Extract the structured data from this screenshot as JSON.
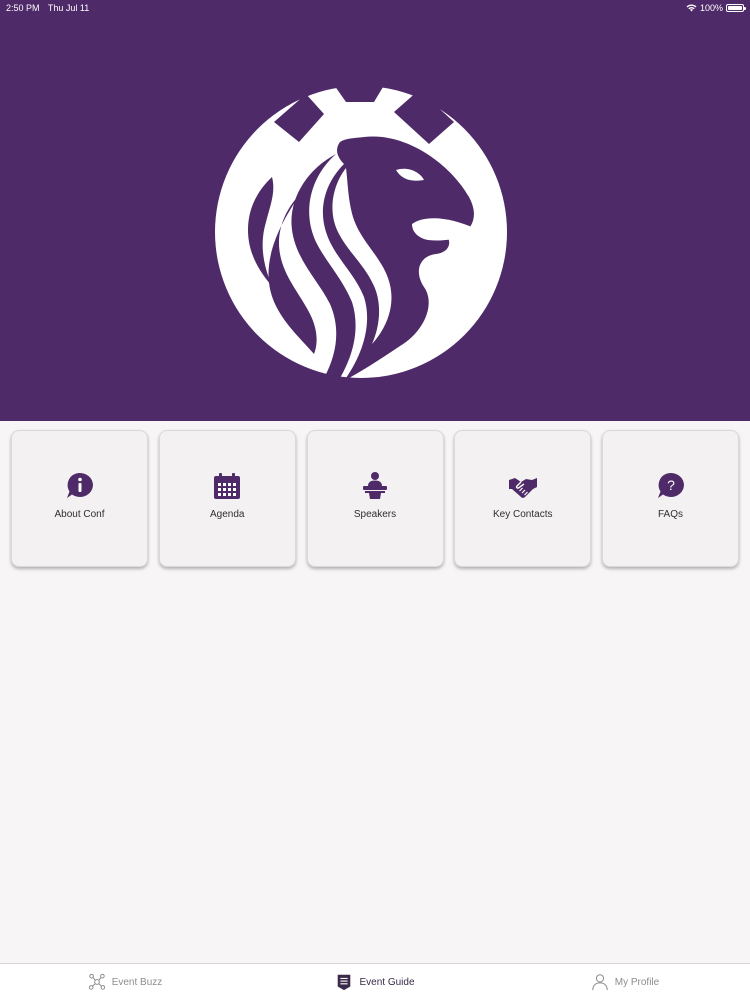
{
  "status_bar": {
    "time": "2:50 PM",
    "date": "Thu Jul 11",
    "battery": "100%",
    "battery_level": 1.0
  },
  "colors": {
    "brand": "#4f2a68",
    "background": "#f7f5f5",
    "tile": "#f3f1f1",
    "tab_inactive": "#8d8d8d",
    "tab_active": "#3a2a4a"
  },
  "hero": {
    "logo_icon": "lion-head-logo"
  },
  "tiles": [
    {
      "label": "About Conf",
      "icon": "info-speech-bubble-icon"
    },
    {
      "label": "Agenda",
      "icon": "calendar-icon"
    },
    {
      "label": "Speakers",
      "icon": "speaker-podium-icon"
    },
    {
      "label": "Key Contacts",
      "icon": "handshake-icon"
    },
    {
      "label": "FAQs",
      "icon": "question-speech-bubble-icon"
    }
  ],
  "tab_bar": {
    "tabs": [
      {
        "label": "Event Buzz",
        "icon": "network-icon",
        "active": false
      },
      {
        "label": "Event Guide",
        "icon": "guide-badge-icon",
        "active": true
      },
      {
        "label": "My Profile",
        "icon": "person-icon",
        "active": false
      }
    ]
  }
}
